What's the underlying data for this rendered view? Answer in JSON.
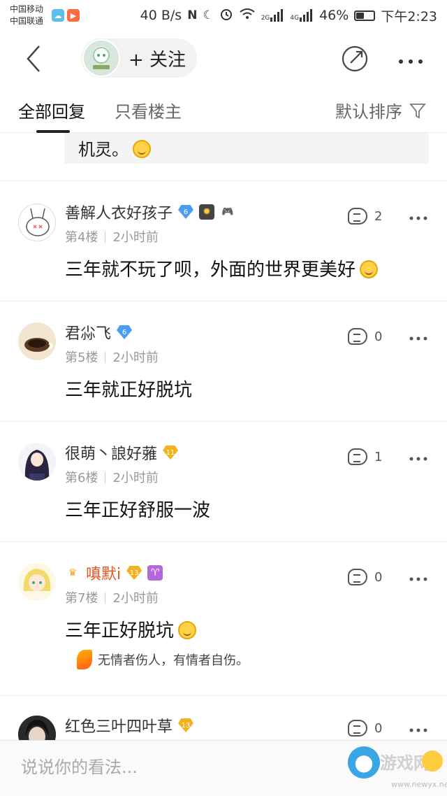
{
  "status_bar": {
    "carrier1": "中国移动",
    "carrier2": "中国联通",
    "net_speed": "40 B/s",
    "icon_nfc": "N",
    "icon_moon": "☾",
    "icon_alarm": "⏰",
    "icon_wifi": "wifi",
    "sig_2g": "2G",
    "sig_4g": "4G",
    "battery": "46%",
    "battery_level": 0.46,
    "time": "下午2:23"
  },
  "header": {
    "follow_label": "+ 关注"
  },
  "tabs": {
    "all": "全部回复",
    "op_only": "只看楼主",
    "sort": "默认排序"
  },
  "quoted_tail": "机灵。",
  "replies": [
    {
      "username": "善解人衣好孩子",
      "level": "6",
      "floor": "第4楼",
      "time": "2小时前",
      "content": "三年就不玩了呗，外面的世界更美好",
      "likes": "2"
    },
    {
      "username": "君尛飞",
      "level": "6",
      "floor": "第5楼",
      "time": "2小时前",
      "content": "三年就正好脱坑",
      "likes": "0"
    },
    {
      "username": "很萌丶誏好蕥",
      "level": "11",
      "floor": "第6楼",
      "time": "2小时前",
      "content": "三年正好舒服一波",
      "likes": "1"
    },
    {
      "username": "嗔默i",
      "level": "13",
      "floor": "第7楼",
      "time": "2小时前",
      "content": "三年正好脱坑",
      "likes": "0",
      "signature": "无情者伤人，有情者自伤。"
    },
    {
      "username": "红色三叶四叶草",
      "level": "13",
      "likes": "0"
    }
  ],
  "input": {
    "placeholder": "说说你的看法..."
  },
  "watermark": {
    "text": "游戏网",
    "url": "www.newyx.net"
  }
}
